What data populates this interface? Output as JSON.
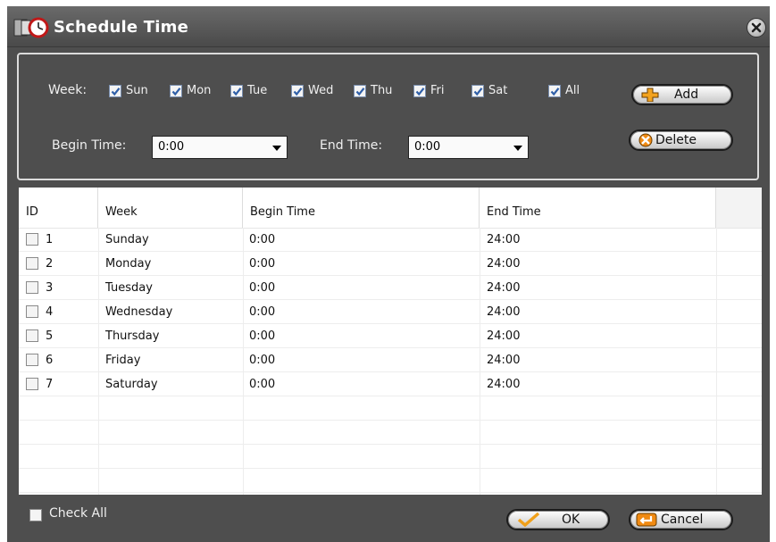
{
  "window": {
    "title": "Schedule Time"
  },
  "icons": {
    "app": "clock-icon",
    "close": "close-icon",
    "add": "plus-icon",
    "delete": "x-icon",
    "ok": "check-icon",
    "cancel": "return-icon"
  },
  "filter": {
    "week_label": "Week:",
    "days": [
      {
        "label": "Sun",
        "checked": true
      },
      {
        "label": "Mon",
        "checked": true
      },
      {
        "label": "Tue",
        "checked": true
      },
      {
        "label": "Wed",
        "checked": true
      },
      {
        "label": "Thu",
        "checked": true
      },
      {
        "label": "Fri",
        "checked": true
      },
      {
        "label": "Sat",
        "checked": true
      },
      {
        "label": "All",
        "checked": true
      }
    ],
    "begin_label": "Begin Time:",
    "begin_value": "0:00",
    "end_label": "End Time:",
    "end_value": "0:00",
    "add_label": "Add",
    "delete_label": "Delete"
  },
  "table": {
    "columns": [
      "ID",
      "Week",
      "Begin Time",
      "End Time"
    ],
    "rows": [
      {
        "id": "1",
        "week": "Sunday",
        "begin": "0:00",
        "end": "24:00",
        "checked": false
      },
      {
        "id": "2",
        "week": "Monday",
        "begin": "0:00",
        "end": "24:00",
        "checked": false
      },
      {
        "id": "3",
        "week": "Tuesday",
        "begin": "0:00",
        "end": "24:00",
        "checked": false
      },
      {
        "id": "4",
        "week": "Wednesday",
        "begin": "0:00",
        "end": "24:00",
        "checked": false
      },
      {
        "id": "5",
        "week": "Thursday",
        "begin": "0:00",
        "end": "24:00",
        "checked": false
      },
      {
        "id": "6",
        "week": "Friday",
        "begin": "0:00",
        "end": "24:00",
        "checked": false
      },
      {
        "id": "7",
        "week": "Saturday",
        "begin": "0:00",
        "end": "24:00",
        "checked": false
      }
    ]
  },
  "footer": {
    "check_all_label": "Check All",
    "check_all_checked": false,
    "ok_label": "OK",
    "cancel_label": "Cancel"
  },
  "colors": {
    "window_bg": "#4e4e4e",
    "text_light": "#f0f0f0",
    "check_blue": "#2f5fa8",
    "add_icon": "#f3a31f",
    "delete_icon": "#f08a12",
    "ok_icon": "#f0a01a"
  }
}
